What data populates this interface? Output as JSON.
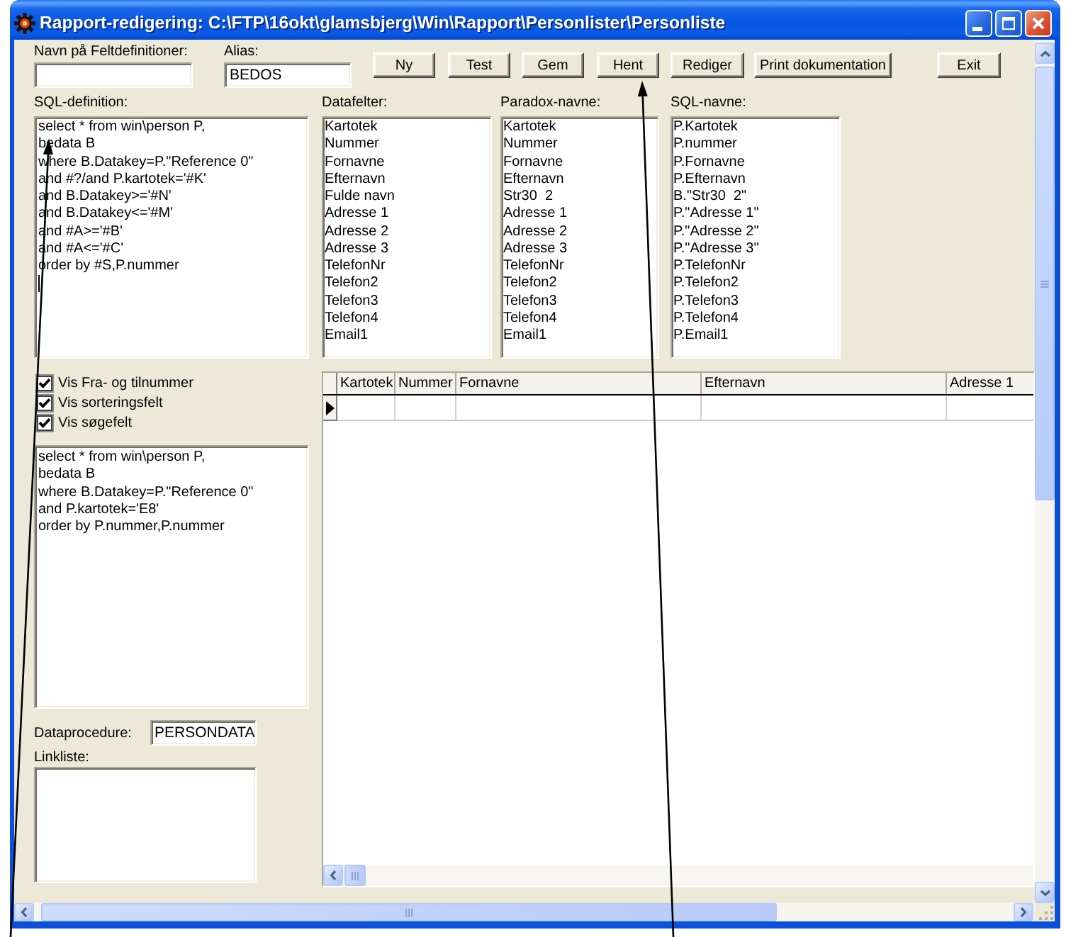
{
  "window": {
    "title": "Rapport-redigering: C:\\FTP\\16okt\\glamsbjerg\\Win\\Rapport\\Personlister\\Personliste"
  },
  "name_field": {
    "label": "Navn på Feltdefinitioner:"
  },
  "alias_field": {
    "label": "Alias:",
    "value": "BEDOS"
  },
  "buttons": [
    {
      "label": "Ny"
    },
    {
      "label": "Test"
    },
    {
      "label": "Gem"
    },
    {
      "label": "Hent"
    },
    {
      "label": "Rediger"
    },
    {
      "label": "Print dokumentation"
    },
    {
      "label": "Exit"
    }
  ],
  "sql_definition": {
    "label": "SQL-definition:",
    "value": "select * from win\\person P,\nbedata B\nwhere B.Datakey=P.\"Reference 0\"\nand #?/and P.kartotek='#K'\nand B.Datakey>='#N'\nand B.Datakey<='#M'\nand #A>='#B'\nand #A<='#C'\norder by #S,P.nummer",
    "focused": true
  },
  "lists": [
    {
      "label": "Datafelter:",
      "items": [
        "Kartotek",
        "Nummer",
        "Fornavne",
        "Efternavn",
        "Fulde navn",
        "Adresse 1",
        "Adresse 2",
        "Adresse 3",
        "TelefonNr",
        "Telefon2",
        "Telefon3",
        "Telefon4",
        "Email1"
      ]
    },
    {
      "label": "Paradox-navne:",
      "items": [
        "Kartotek",
        "Nummer",
        "Fornavne",
        "Efternavn",
        "Str30  2",
        "Adresse 1",
        "Adresse 2",
        "Adresse 3",
        "TelefonNr",
        "Telefon2",
        "Telefon3",
        "Telefon4",
        "Email1"
      ]
    },
    {
      "label": "SQL-navne:",
      "items": [
        "P.Kartotek",
        "P.nummer",
        "P.Fornavne",
        "P.Efternavn",
        "B.\"Str30  2\"",
        "P.\"Adresse 1\"",
        "P.\"Adresse 2\"",
        "P.\"Adresse 3\"",
        "P.TelefonNr",
        "P.Telefon2",
        "P.Telefon3",
        "P.Telefon4",
        "P.Email1"
      ]
    }
  ],
  "options": [
    {
      "label": "Vis Fra- og tilnummer",
      "checked": true
    },
    {
      "label": "Vis sorteringsfelt",
      "checked": true
    },
    {
      "label": "Vis søgefelt",
      "checked": true
    }
  ],
  "sql_preview": {
    "value": "select * from win\\person P,\nbedata B\nwhere B.Datakey=P.\"Reference 0\"\nand P.kartotek='E8'\norder by P.nummer,P.nummer"
  },
  "grid": {
    "columns": [
      "Kartotek",
      "Nummer",
      "Fornavne",
      "Efternavn",
      "Adresse 1"
    ],
    "rows": [
      {
        "current": true
      }
    ]
  },
  "dataprocedure": {
    "label": "Dataprocedure:",
    "value": "PERSONDATA"
  },
  "linkliste": {
    "label": "Linkliste:"
  }
}
